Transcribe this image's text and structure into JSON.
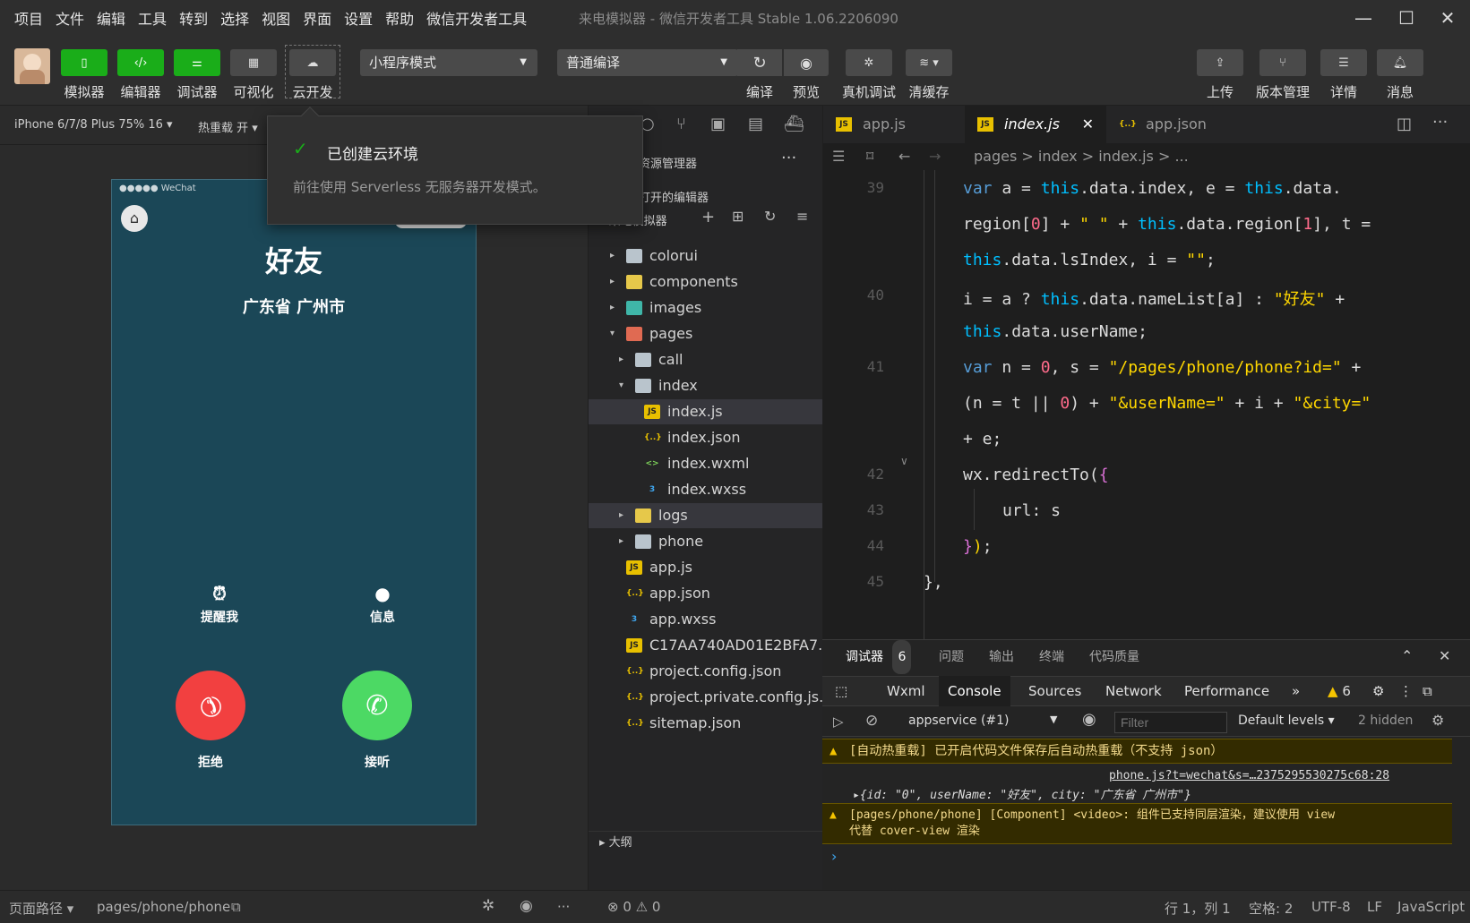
{
  "menu": [
    "项目",
    "文件",
    "编辑",
    "工具",
    "转到",
    "选择",
    "视图",
    "界面",
    "设置",
    "帮助",
    "微信开发者工具"
  ],
  "window_title": "来电模拟器 - 微信开发者工具 Stable 1.06.2206090",
  "toolbar": {
    "buttons": [
      {
        "label": "模拟器",
        "icon": "phone-icon"
      },
      {
        "label": "编辑器",
        "icon": "code-icon"
      },
      {
        "label": "调试器",
        "icon": "debug-icon"
      },
      {
        "label": "可视化",
        "icon": "layout-icon"
      },
      {
        "label": "云开发",
        "icon": "cloud-icon"
      }
    ],
    "mode_select": "小程序模式",
    "compile_select": "普通编译",
    "actions": [
      "编译",
      "预览",
      "真机调试",
      "清缓存"
    ],
    "right": [
      "上传",
      "版本管理",
      "详情",
      "消息"
    ]
  },
  "subbar": {
    "device": "iPhone 6/7/8 Plus 75% 16 ▾",
    "hotreload": "热重载 开 ▾"
  },
  "toast": {
    "title": "已创建云环境",
    "message": "前往使用 Serverless 无服务器开发模式。"
  },
  "simulator": {
    "status_carrier": "●●●●● WeChat",
    "caller_name": "好友",
    "caller_city": "广东省 广州市",
    "remind": "提醒我",
    "message": "信息",
    "decline": "拒绝",
    "accept": "接听"
  },
  "explorer": {
    "header": "资源管理器",
    "open_editors": "打开的编辑器",
    "project": "来电模拟器",
    "outline": "大纲",
    "tree": [
      {
        "name": "colorui",
        "type": "folder",
        "color": "gray",
        "depth": 0,
        "arrow": "▸"
      },
      {
        "name": "components",
        "type": "folder",
        "color": "y",
        "depth": 0,
        "arrow": "▸"
      },
      {
        "name": "images",
        "type": "folder",
        "color": "g",
        "depth": 0,
        "arrow": "▸"
      },
      {
        "name": "pages",
        "type": "folder",
        "color": "r",
        "depth": 0,
        "arrow": "▾"
      },
      {
        "name": "call",
        "type": "folder",
        "color": "gray",
        "depth": 1,
        "arrow": "▸"
      },
      {
        "name": "index",
        "type": "folder",
        "color": "gray",
        "depth": 1,
        "arrow": "▾"
      },
      {
        "name": "index.js",
        "type": "js",
        "depth": 2,
        "selected": true
      },
      {
        "name": "index.json",
        "type": "json",
        "depth": 2
      },
      {
        "name": "index.wxml",
        "type": "wxml",
        "depth": 2
      },
      {
        "name": "index.wxss",
        "type": "wxss",
        "depth": 2
      },
      {
        "name": "logs",
        "type": "folder",
        "color": "y",
        "depth": 1,
        "arrow": "▸",
        "hover": true
      },
      {
        "name": "phone",
        "type": "folder",
        "color": "gray",
        "depth": 1,
        "arrow": "▸"
      },
      {
        "name": "app.js",
        "type": "js",
        "depth": 0
      },
      {
        "name": "app.json",
        "type": "json",
        "depth": 0
      },
      {
        "name": "app.wxss",
        "type": "wxss",
        "depth": 0
      },
      {
        "name": "C17AA740AD01E2BFA7...",
        "type": "js",
        "depth": 0
      },
      {
        "name": "project.config.json",
        "type": "json",
        "depth": 0
      },
      {
        "name": "project.private.config.js...",
        "type": "json",
        "depth": 0
      },
      {
        "name": "sitemap.json",
        "type": "json",
        "depth": 0
      }
    ]
  },
  "editor": {
    "tabs": [
      {
        "name": "app.js",
        "type": "js"
      },
      {
        "name": "index.js",
        "type": "js",
        "active": true
      },
      {
        "name": "app.json",
        "type": "json"
      }
    ],
    "breadcrumb": "pages > index > index.js > ...",
    "line_numbers": [
      "39",
      "40",
      "41",
      "42",
      "43",
      "44",
      "45"
    ]
  },
  "console": {
    "tabs": [
      "调试器",
      "问题",
      "输出",
      "终端",
      "代码质量"
    ],
    "badge": "6",
    "devtabs": [
      "Wxml",
      "Console",
      "Sources",
      "Network",
      "Performance"
    ],
    "warn_count": "6",
    "context": "appservice (#1)",
    "filter_placeholder": "Filter",
    "levels": "Default levels ▾",
    "hidden": "2 hidden",
    "msg1": "[自动热重载] 已开启代码文件保存后自动热重载（不支持 json）",
    "link": "phone.js?t=wechat&s=…2375295530275c68:28",
    "log_obj": "▸{id: \"0\", userName: \"好友\", city: \"广东省 广州市\"}",
    "msg2a": "[pages/phone/phone] [Component] <video>: 组件已支持同层渲染，建议使用 view",
    "msg2b": "代替 cover-view 渲染",
    "prompt": "›"
  },
  "statusbar": {
    "path_label": "页面路径 ▾",
    "path": "pages/phone/phone",
    "errors": "⊗ 0 ⚠ 0",
    "pos": "行 1，列 1",
    "indent": "空格: 2",
    "enc": "UTF-8",
    "eol": "LF",
    "lang": "JavaScript"
  }
}
